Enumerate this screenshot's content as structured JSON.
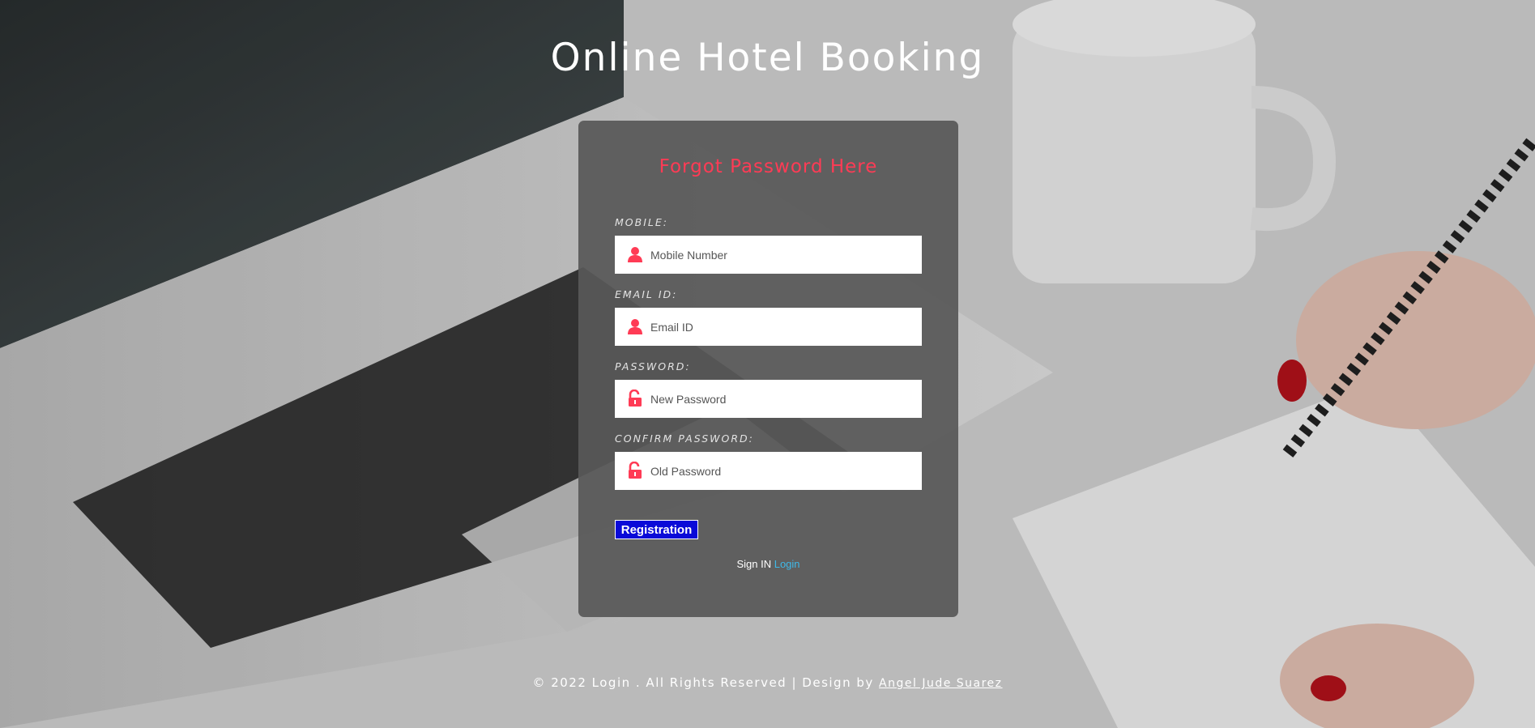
{
  "page": {
    "title": "Online Hotel Booking"
  },
  "form": {
    "title": "Forgot Password Here",
    "fields": [
      {
        "label": "MOBILE:",
        "placeholder": "Mobile Number",
        "icon": "user-icon"
      },
      {
        "label": "EMAIL ID:",
        "placeholder": "Email ID",
        "icon": "user-icon"
      },
      {
        "label": "PASSWORD:",
        "placeholder": "New Password",
        "icon": "unlock-icon"
      },
      {
        "label": "CONFIRM PASSWORD:",
        "placeholder": "Old Password",
        "icon": "unlock-icon"
      }
    ],
    "submit_label": "Registration",
    "signin_text": "Sign IN",
    "signin_link": "Login"
  },
  "footer": {
    "text": "© 2022 Login . All Rights Reserved | Design by",
    "link": "Angel Jude Suarez"
  },
  "colors": {
    "accent": "#ff3b55",
    "button": "#0a0ad8",
    "link": "#3fb9e8"
  }
}
